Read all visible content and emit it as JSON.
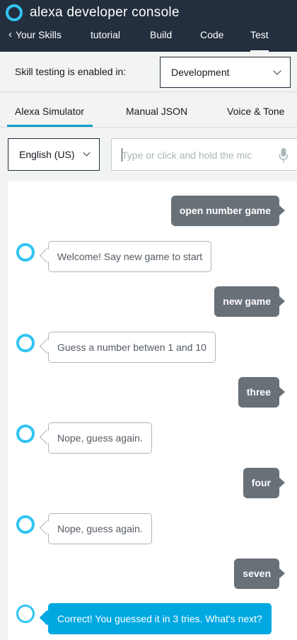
{
  "header": {
    "title": "alexa developer console",
    "back_label": "Your Skills",
    "nav": [
      "tutorial",
      "Build",
      "Code",
      "Test"
    ],
    "active_nav": "Test"
  },
  "testing": {
    "label": "Skill testing is enabled in:",
    "stage_value": "Development"
  },
  "tabs": {
    "items": [
      "Alexa Simulator",
      "Manual JSON",
      "Voice & Tone"
    ],
    "active": "Alexa Simulator"
  },
  "controls": {
    "language": "English (US)",
    "utterance_placeholder": "Type or click and hold the mic"
  },
  "conversation": [
    {
      "speaker": "user",
      "text": "open number game"
    },
    {
      "speaker": "alexa",
      "text": "Welcome! Say new game to start"
    },
    {
      "speaker": "user",
      "text": "new game"
    },
    {
      "speaker": "alexa",
      "text": "Guess a number betwen 1 and 10"
    },
    {
      "speaker": "user",
      "text": "three"
    },
    {
      "speaker": "alexa",
      "text": "Nope, guess again."
    },
    {
      "speaker": "user",
      "text": "four"
    },
    {
      "speaker": "alexa",
      "text": "Nope, guess again."
    },
    {
      "speaker": "user",
      "text": "seven"
    },
    {
      "speaker": "alexa",
      "text": "Correct! You guessed it in 3 tries. What's next?"
    }
  ],
  "colors": {
    "header_bg": "#232f3e",
    "accent": "#31c4f3",
    "tab_active": "#0f9ec7",
    "user_bubble": "#687078",
    "final_bubble": "#00a8e1"
  },
  "icons": {
    "brand": "alexa-ring-icon",
    "back": "chevron-left-icon",
    "dropdown": "chevron-down-icon",
    "mic": "microphone-icon"
  }
}
